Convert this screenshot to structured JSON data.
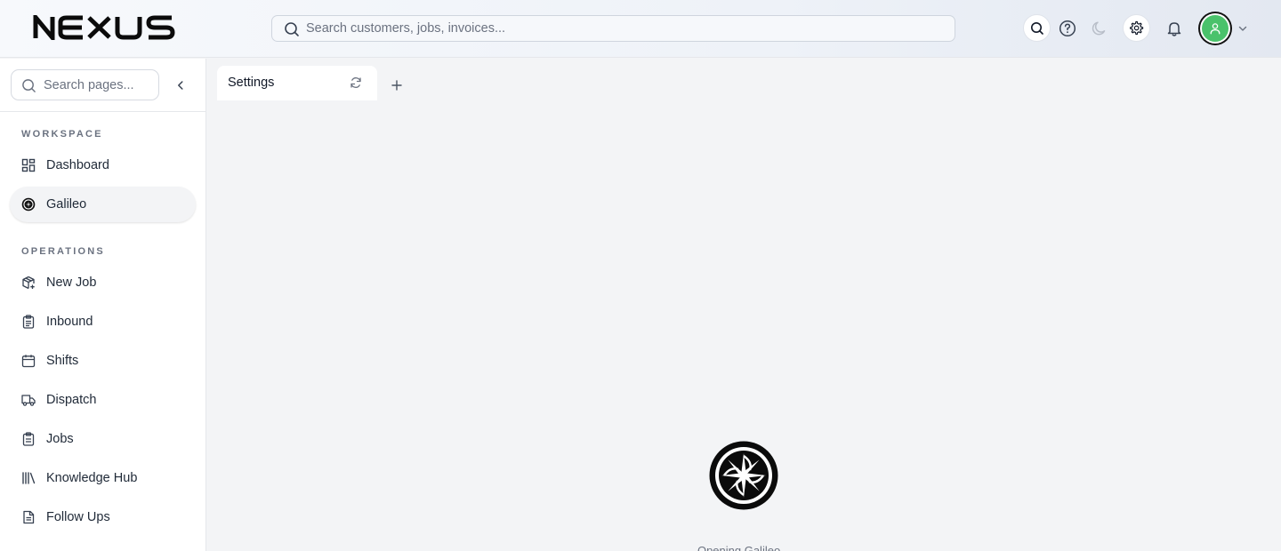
{
  "brand": {
    "name": "NEXUS"
  },
  "header": {
    "search_placeholder": "Search customers, jobs, invoices...",
    "icons": [
      "search-icon",
      "help-icon",
      "moon-icon",
      "gear-icon",
      "bell-icon",
      "user-icon",
      "chevron-down-icon"
    ],
    "avatar_color": "#4ac26b"
  },
  "sidebar": {
    "search_placeholder": "Search pages...",
    "sections": [
      {
        "title": "WORKSPACE",
        "items": [
          {
            "label": "Dashboard",
            "icon": "grid-icon",
            "active": false
          },
          {
            "label": "Galileo",
            "icon": "galileo-icon",
            "active": true
          }
        ]
      },
      {
        "title": "OPERATIONS",
        "items": [
          {
            "label": "New Job",
            "icon": "package-plus-icon",
            "active": false
          },
          {
            "label": "Inbound",
            "icon": "clipboard-list-icon",
            "active": false
          },
          {
            "label": "Shifts",
            "icon": "calendar-icon",
            "active": false
          },
          {
            "label": "Dispatch",
            "icon": "truck-icon",
            "active": false
          },
          {
            "label": "Jobs",
            "icon": "clipboard-icon",
            "active": false
          },
          {
            "label": "Knowledge Hub",
            "icon": "library-icon",
            "active": false
          },
          {
            "label": "Follow Ups",
            "icon": "file-text-icon",
            "active": false
          }
        ]
      }
    ]
  },
  "tabs": [
    {
      "label": "Settings",
      "active": true
    }
  ],
  "main": {
    "loading_text": "Opening Galileo..."
  }
}
